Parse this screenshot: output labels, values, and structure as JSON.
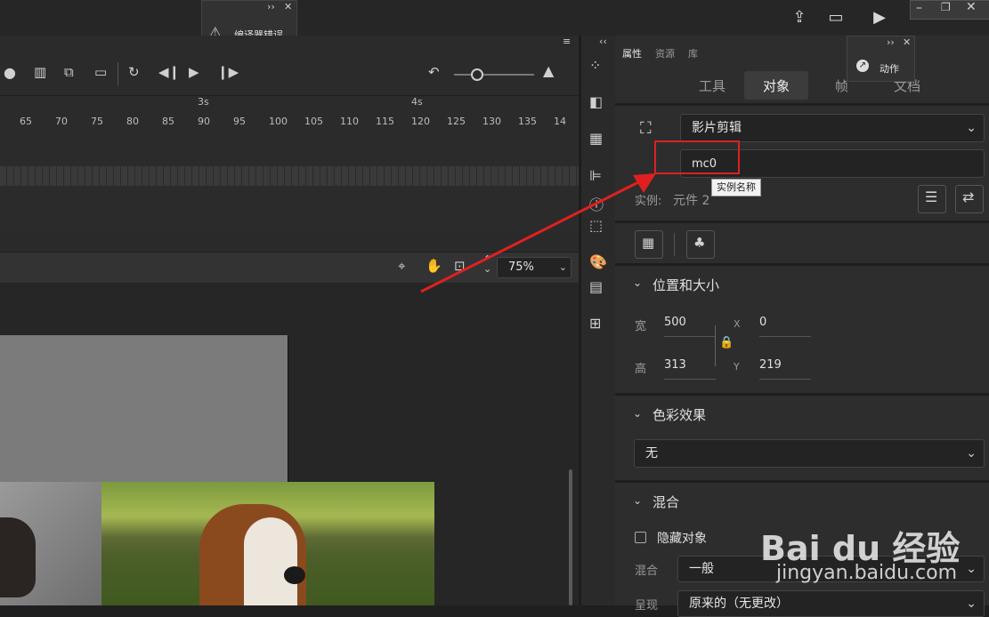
{
  "popup": {
    "error_label": "编译器错误",
    "action_label": "动作"
  },
  "timeline": {
    "ruler_seconds": [
      "3s",
      "4s"
    ],
    "ruler_frames": [
      "65",
      "70",
      "75",
      "80",
      "85",
      "90",
      "95",
      "100",
      "105",
      "110",
      "115",
      "120",
      "125",
      "130",
      "135",
      "14"
    ]
  },
  "stage": {
    "zoom": "75%"
  },
  "props": {
    "tabs": [
      "属性",
      "资源",
      "库"
    ],
    "subtabs": [
      "工具",
      "对象",
      "帧",
      "文档"
    ],
    "active_subtab": "对象",
    "symbol_type": "影片剪辑",
    "instance_name": "mc0",
    "instance_tooltip": "实例名称",
    "instance_label": "实例:",
    "instance_value": "元件 2",
    "position_section": "位置和大小",
    "width_label": "宽",
    "width_value": "500",
    "height_label": "高",
    "height_value": "313",
    "x_label": "X",
    "x_value": "0",
    "y_label": "Y",
    "y_value": "219",
    "color_section": "色彩效果",
    "color_value": "无",
    "blend_section": "混合",
    "hide_object_label": "隐藏对象",
    "blend_label": "混合",
    "blend_value": "一般",
    "render_label": "呈现",
    "render_value": "原来的（无更改）"
  },
  "watermark": {
    "brand": "Bai du 经验",
    "url": "jingyan.baidu.com"
  },
  "colors": {
    "highlight_red": "#e02020",
    "accent_blue": "#2d7ff9"
  }
}
